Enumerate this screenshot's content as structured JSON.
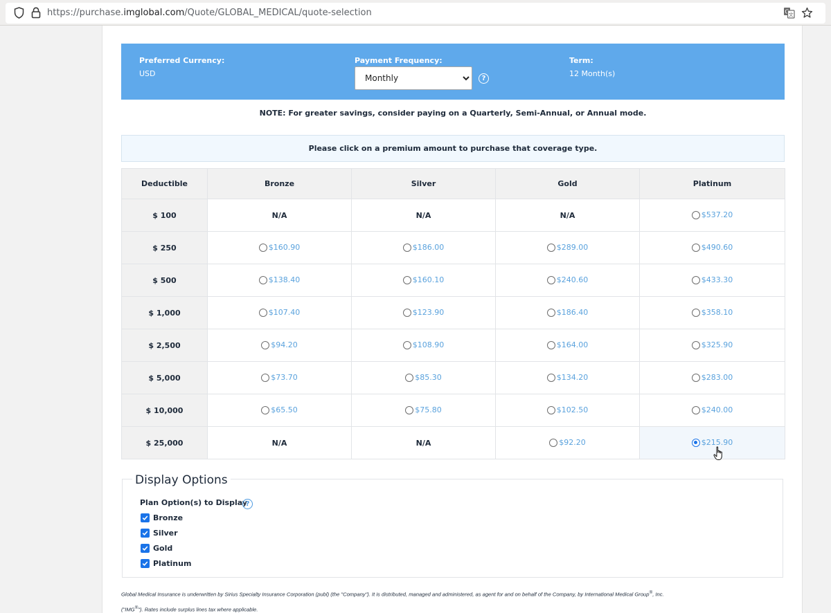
{
  "browser": {
    "url_prefix": "https://purchase.",
    "url_domain": "imglobal.com",
    "url_path": "/Quote/GLOBAL_MEDICAL/quote-selection"
  },
  "header": {
    "currency_label": "Preferred Currency:",
    "currency_value": "USD",
    "frequency_label": "Payment Frequency:",
    "frequency_value": "Monthly",
    "term_label": "Term:",
    "term_value": "12 Month(s)",
    "help_glyph": "?"
  },
  "note": "NOTE: For greater savings, consider paying on a Quarterly, Semi-Annual, or Annual mode.",
  "instruction": "Please click on a premium amount to purchase that coverage type.",
  "table": {
    "columns": [
      "Deductible",
      "Bronze",
      "Silver",
      "Gold",
      "Platinum"
    ],
    "rows": [
      {
        "deductible": "$ 100",
        "cells": [
          "N/A",
          "N/A",
          "N/A",
          "$537.20"
        ]
      },
      {
        "deductible": "$ 250",
        "cells": [
          "$160.90",
          "$186.00",
          "$289.00",
          "$490.60"
        ]
      },
      {
        "deductible": "$ 500",
        "cells": [
          "$138.40",
          "$160.10",
          "$240.60",
          "$433.30"
        ]
      },
      {
        "deductible": "$ 1,000",
        "cells": [
          "$107.40",
          "$123.90",
          "$186.40",
          "$358.10"
        ]
      },
      {
        "deductible": "$ 2,500",
        "cells": [
          "$94.20",
          "$108.90",
          "$164.00",
          "$325.90"
        ]
      },
      {
        "deductible": "$ 5,000",
        "cells": [
          "$73.70",
          "$85.30",
          "$134.20",
          "$283.00"
        ]
      },
      {
        "deductible": "$ 10,000",
        "cells": [
          "$65.50",
          "$75.80",
          "$102.50",
          "$240.00"
        ]
      },
      {
        "deductible": "$ 25,000",
        "cells": [
          "N/A",
          "N/A",
          "$92.20",
          "$215.90"
        ]
      }
    ],
    "selected": {
      "row": 7,
      "col": 3
    }
  },
  "display_options": {
    "legend": "Display Options",
    "plan_label": "Plan Option(s) to Display",
    "plans": [
      {
        "label": "Bronze",
        "checked": true
      },
      {
        "label": "Silver",
        "checked": true
      },
      {
        "label": "Gold",
        "checked": true
      },
      {
        "label": "Platinum",
        "checked": true
      }
    ]
  },
  "footer": {
    "line1": "Global Medical Insurance is underwritten by Sirius Specialty Insurance Corporation (publ) (the \"Company\"). It is distributed, managed and administered, as agent for and on behalf of the Company, by International Medical Group",
    "line1_sup": "®",
    "line1_end": ", Inc.",
    "line2_start": "(\"IMG",
    "line2_sup": "®",
    "line2_end": "\"). Rates include surplus lines tax where applicable."
  },
  "colors": {
    "header_blue": "#5fa9eb",
    "link_blue": "#5aa2dd",
    "checkbox_blue": "#1a73e8"
  }
}
